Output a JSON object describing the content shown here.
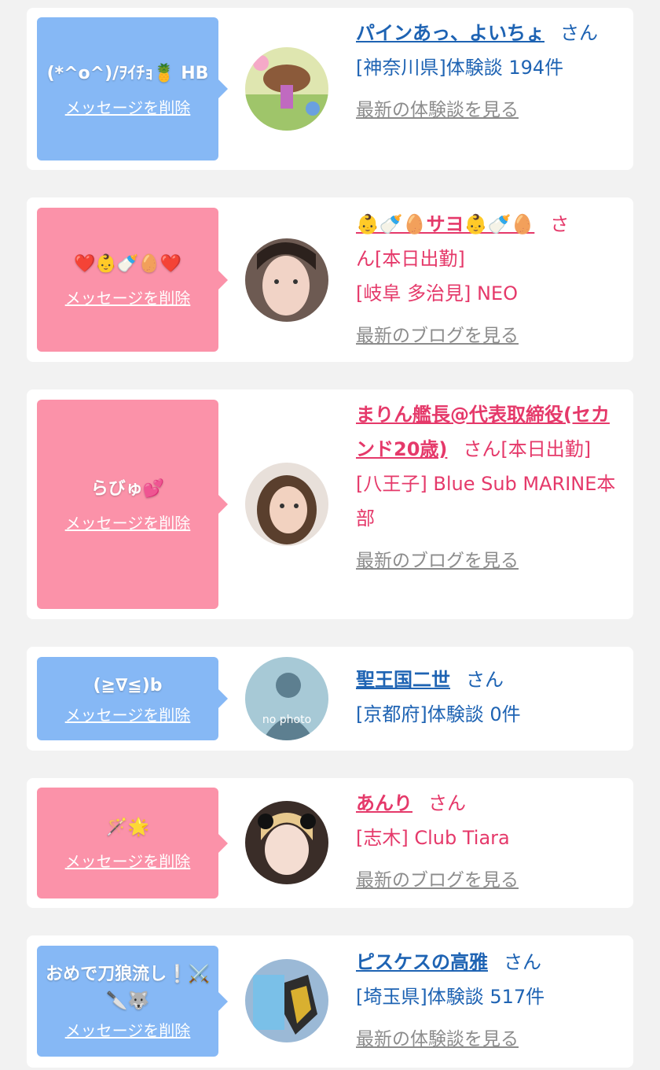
{
  "items": [
    {
      "message": "(*^o^)/ｦｲﾁｮ🍍 HB",
      "delete_label": "メッセージを削除",
      "name": "パインあっ、よいちょ",
      "honorific": "さん",
      "detail1": "[神奈川県]体験談 194件",
      "detail2": "",
      "latest_link": "最新の体験談を見る",
      "type": "blue"
    },
    {
      "message": "❤️👶🍼🥚❤️",
      "delete_label": "メッセージを削除",
      "name": "👶🍼🥚サヨ👶🍼🥚",
      "honorific": "さ",
      "detail1": "ん[本日出勤]",
      "detail2": "[岐阜 多治見] NEO",
      "latest_link": "最新のブログを見る",
      "type": "pink"
    },
    {
      "message": "らびゅ💕",
      "delete_label": "メッセージを削除",
      "name": "まりん艦長@代表取締役(セカンド20歳)",
      "honorific": "さん[本日出勤]",
      "detail1": "[八王子] Blue Sub MARINE本部",
      "detail2": "",
      "latest_link": "最新のブログを見る",
      "type": "pink"
    },
    {
      "message": "(≧∇≦)b",
      "delete_label": "メッセージを削除",
      "name": "聖王国二世",
      "honorific": "さん",
      "detail1": "[京都府]体験談 0件",
      "detail2": "",
      "latest_link": "",
      "avatar_text": "no photo",
      "type": "blue"
    },
    {
      "message": "🪄🌟",
      "delete_label": "メッセージを削除",
      "name": "あんり",
      "honorific": "さん",
      "detail1": "[志木] Club Tiara",
      "detail2": "",
      "latest_link": "最新のブログを見る",
      "type": "pink"
    },
    {
      "message": "おめで刀狼流し❕⚔️🔪🐺",
      "delete_label": "メッセージを削除",
      "name": "ピスケスの高雅",
      "honorific": "さん",
      "detail1": "[埼玉県]体験談 517件",
      "detail2": "",
      "latest_link": "最新の体験談を見る",
      "type": "blue"
    }
  ]
}
